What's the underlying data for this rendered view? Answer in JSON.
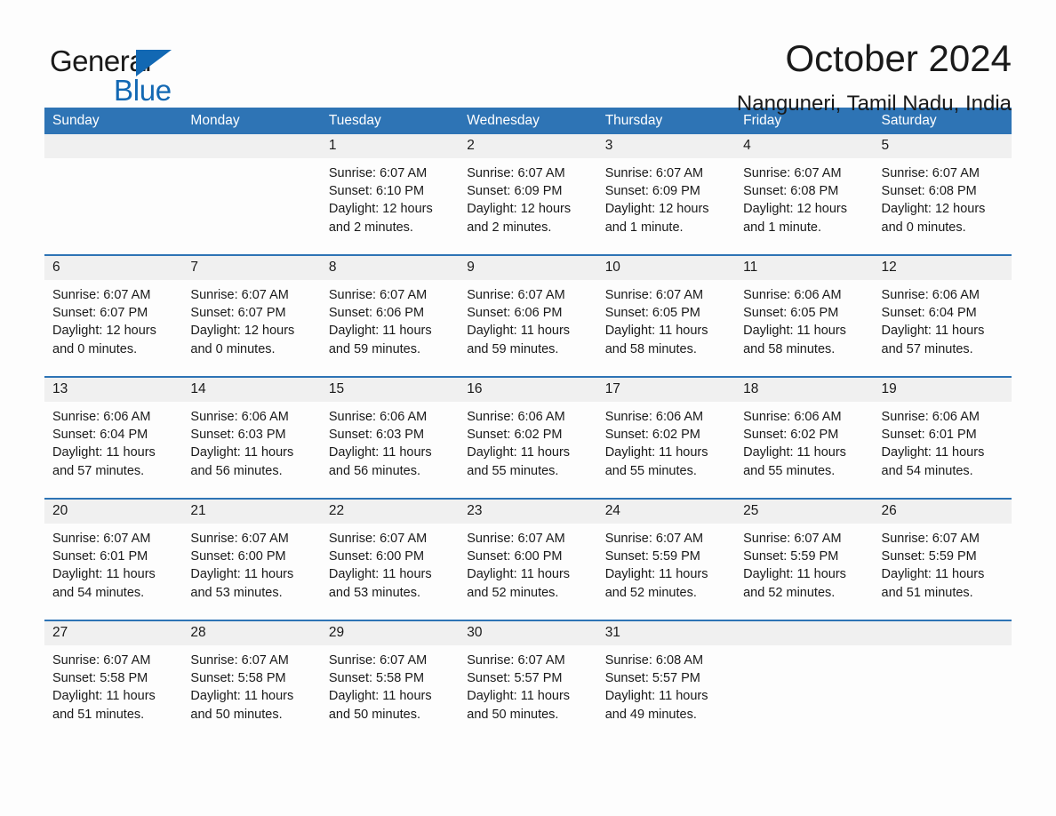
{
  "brand": {
    "name_part1": "General",
    "name_part2": "Blue",
    "accent_color": "#1268b3",
    "triangle_icon": "triangle-icon"
  },
  "header": {
    "title": "October 2024",
    "subtitle": "Nanguneri, Tamil Nadu, India"
  },
  "calendar": {
    "header_bg": "#2e74b5",
    "weekdays": [
      "Sunday",
      "Monday",
      "Tuesday",
      "Wednesday",
      "Thursday",
      "Friday",
      "Saturday"
    ],
    "weeks": [
      [
        {
          "day": "",
          "lines": []
        },
        {
          "day": "",
          "lines": []
        },
        {
          "day": "1",
          "lines": [
            "Sunrise: 6:07 AM",
            "Sunset: 6:10 PM",
            "Daylight: 12 hours",
            "and 2 minutes."
          ]
        },
        {
          "day": "2",
          "lines": [
            "Sunrise: 6:07 AM",
            "Sunset: 6:09 PM",
            "Daylight: 12 hours",
            "and 2 minutes."
          ]
        },
        {
          "day": "3",
          "lines": [
            "Sunrise: 6:07 AM",
            "Sunset: 6:09 PM",
            "Daylight: 12 hours",
            "and 1 minute."
          ]
        },
        {
          "day": "4",
          "lines": [
            "Sunrise: 6:07 AM",
            "Sunset: 6:08 PM",
            "Daylight: 12 hours",
            "and 1 minute."
          ]
        },
        {
          "day": "5",
          "lines": [
            "Sunrise: 6:07 AM",
            "Sunset: 6:08 PM",
            "Daylight: 12 hours",
            "and 0 minutes."
          ]
        }
      ],
      [
        {
          "day": "6",
          "lines": [
            "Sunrise: 6:07 AM",
            "Sunset: 6:07 PM",
            "Daylight: 12 hours",
            "and 0 minutes."
          ]
        },
        {
          "day": "7",
          "lines": [
            "Sunrise: 6:07 AM",
            "Sunset: 6:07 PM",
            "Daylight: 12 hours",
            "and 0 minutes."
          ]
        },
        {
          "day": "8",
          "lines": [
            "Sunrise: 6:07 AM",
            "Sunset: 6:06 PM",
            "Daylight: 11 hours",
            "and 59 minutes."
          ]
        },
        {
          "day": "9",
          "lines": [
            "Sunrise: 6:07 AM",
            "Sunset: 6:06 PM",
            "Daylight: 11 hours",
            "and 59 minutes."
          ]
        },
        {
          "day": "10",
          "lines": [
            "Sunrise: 6:07 AM",
            "Sunset: 6:05 PM",
            "Daylight: 11 hours",
            "and 58 minutes."
          ]
        },
        {
          "day": "11",
          "lines": [
            "Sunrise: 6:06 AM",
            "Sunset: 6:05 PM",
            "Daylight: 11 hours",
            "and 58 minutes."
          ]
        },
        {
          "day": "12",
          "lines": [
            "Sunrise: 6:06 AM",
            "Sunset: 6:04 PM",
            "Daylight: 11 hours",
            "and 57 minutes."
          ]
        }
      ],
      [
        {
          "day": "13",
          "lines": [
            "Sunrise: 6:06 AM",
            "Sunset: 6:04 PM",
            "Daylight: 11 hours",
            "and 57 minutes."
          ]
        },
        {
          "day": "14",
          "lines": [
            "Sunrise: 6:06 AM",
            "Sunset: 6:03 PM",
            "Daylight: 11 hours",
            "and 56 minutes."
          ]
        },
        {
          "day": "15",
          "lines": [
            "Sunrise: 6:06 AM",
            "Sunset: 6:03 PM",
            "Daylight: 11 hours",
            "and 56 minutes."
          ]
        },
        {
          "day": "16",
          "lines": [
            "Sunrise: 6:06 AM",
            "Sunset: 6:02 PM",
            "Daylight: 11 hours",
            "and 55 minutes."
          ]
        },
        {
          "day": "17",
          "lines": [
            "Sunrise: 6:06 AM",
            "Sunset: 6:02 PM",
            "Daylight: 11 hours",
            "and 55 minutes."
          ]
        },
        {
          "day": "18",
          "lines": [
            "Sunrise: 6:06 AM",
            "Sunset: 6:02 PM",
            "Daylight: 11 hours",
            "and 55 minutes."
          ]
        },
        {
          "day": "19",
          "lines": [
            "Sunrise: 6:06 AM",
            "Sunset: 6:01 PM",
            "Daylight: 11 hours",
            "and 54 minutes."
          ]
        }
      ],
      [
        {
          "day": "20",
          "lines": [
            "Sunrise: 6:07 AM",
            "Sunset: 6:01 PM",
            "Daylight: 11 hours",
            "and 54 minutes."
          ]
        },
        {
          "day": "21",
          "lines": [
            "Sunrise: 6:07 AM",
            "Sunset: 6:00 PM",
            "Daylight: 11 hours",
            "and 53 minutes."
          ]
        },
        {
          "day": "22",
          "lines": [
            "Sunrise: 6:07 AM",
            "Sunset: 6:00 PM",
            "Daylight: 11 hours",
            "and 53 minutes."
          ]
        },
        {
          "day": "23",
          "lines": [
            "Sunrise: 6:07 AM",
            "Sunset: 6:00 PM",
            "Daylight: 11 hours",
            "and 52 minutes."
          ]
        },
        {
          "day": "24",
          "lines": [
            "Sunrise: 6:07 AM",
            "Sunset: 5:59 PM",
            "Daylight: 11 hours",
            "and 52 minutes."
          ]
        },
        {
          "day": "25",
          "lines": [
            "Sunrise: 6:07 AM",
            "Sunset: 5:59 PM",
            "Daylight: 11 hours",
            "and 52 minutes."
          ]
        },
        {
          "day": "26",
          "lines": [
            "Sunrise: 6:07 AM",
            "Sunset: 5:59 PM",
            "Daylight: 11 hours",
            "and 51 minutes."
          ]
        }
      ],
      [
        {
          "day": "27",
          "lines": [
            "Sunrise: 6:07 AM",
            "Sunset: 5:58 PM",
            "Daylight: 11 hours",
            "and 51 minutes."
          ]
        },
        {
          "day": "28",
          "lines": [
            "Sunrise: 6:07 AM",
            "Sunset: 5:58 PM",
            "Daylight: 11 hours",
            "and 50 minutes."
          ]
        },
        {
          "day": "29",
          "lines": [
            "Sunrise: 6:07 AM",
            "Sunset: 5:58 PM",
            "Daylight: 11 hours",
            "and 50 minutes."
          ]
        },
        {
          "day": "30",
          "lines": [
            "Sunrise: 6:07 AM",
            "Sunset: 5:57 PM",
            "Daylight: 11 hours",
            "and 50 minutes."
          ]
        },
        {
          "day": "31",
          "lines": [
            "Sunrise: 6:08 AM",
            "Sunset: 5:57 PM",
            "Daylight: 11 hours",
            "and 49 minutes."
          ]
        },
        {
          "day": "",
          "lines": []
        },
        {
          "day": "",
          "lines": []
        }
      ]
    ]
  }
}
